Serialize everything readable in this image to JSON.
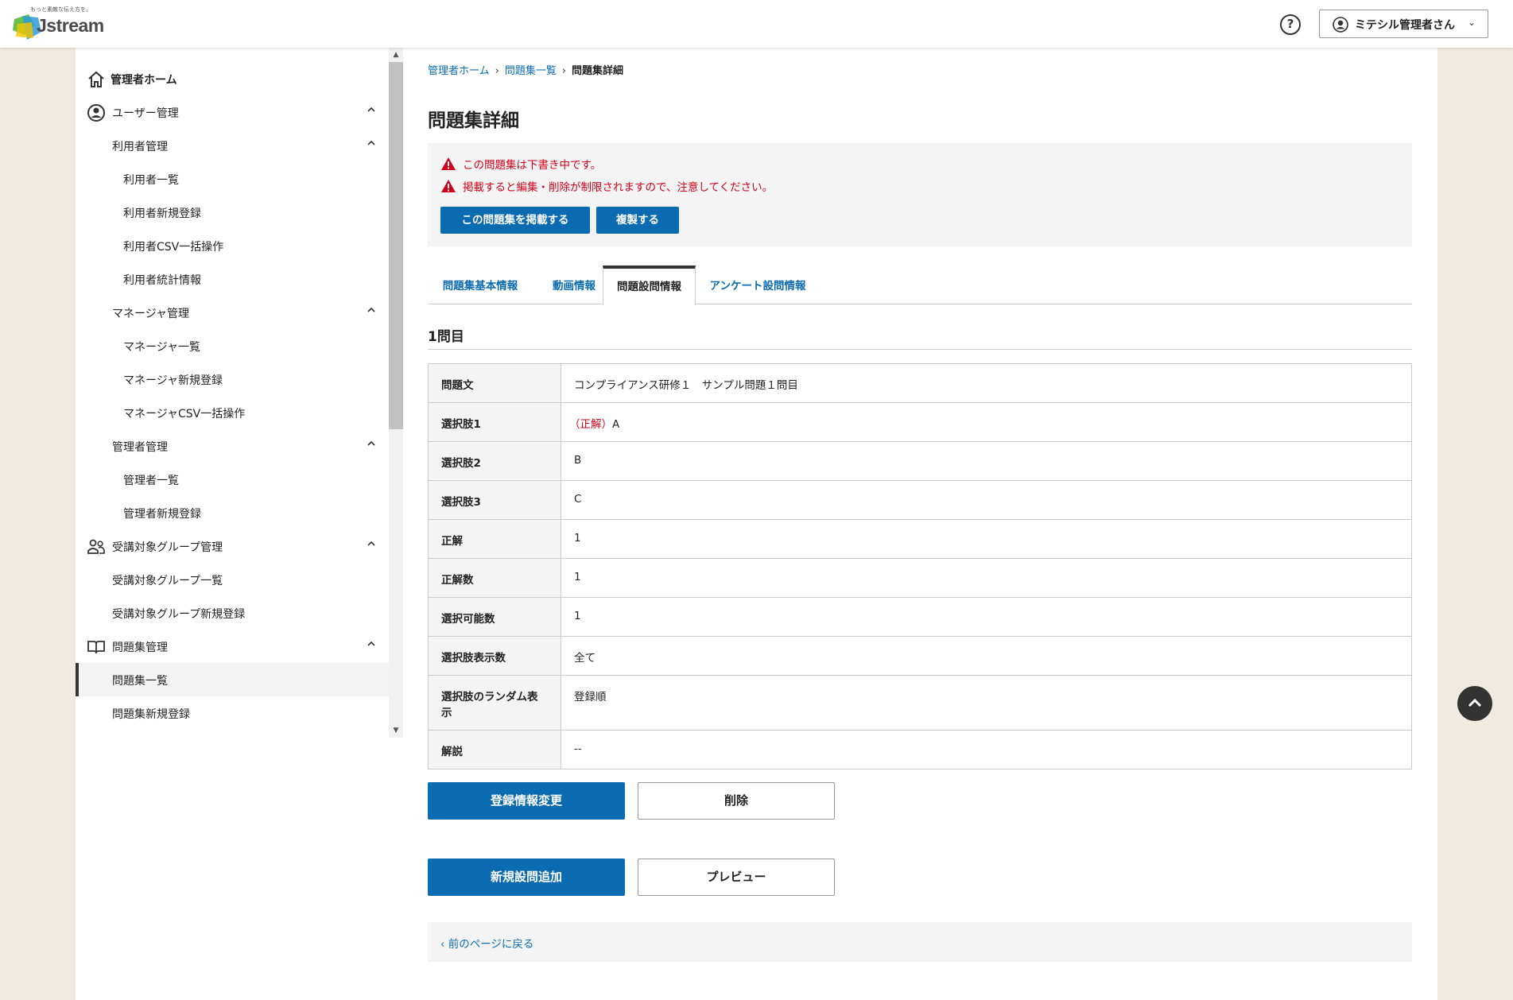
{
  "header": {
    "logo_tagline": "もっと素敵な伝え方を。",
    "logo_text": "Jstream",
    "help_label": "?",
    "user_name": "ミテシル管理者さん"
  },
  "sidebar": {
    "home": "管理者ホーム",
    "user_mgmt": "ユーザー管理",
    "user_sub": "利用者管理",
    "user_list": "利用者一覧",
    "user_new": "利用者新規登録",
    "user_csv": "利用者CSV一括操作",
    "user_stats": "利用者統計情報",
    "mgr_sub": "マネージャ管理",
    "mgr_list": "マネージャ一覧",
    "mgr_new": "マネージャ新規登録",
    "mgr_csv": "マネージャCSV一括操作",
    "admin_sub": "管理者管理",
    "admin_list": "管理者一覧",
    "admin_new": "管理者新規登録",
    "group_mgmt": "受講対象グループ管理",
    "group_list": "受講対象グループ一覧",
    "group_new": "受講対象グループ新規登録",
    "quiz_mgmt": "問題集管理",
    "quiz_list": "問題集一覧",
    "quiz_new": "問題集新規登録"
  },
  "breadcrumb": {
    "home": "管理者ホーム",
    "list": "問題集一覧",
    "current": "問題集詳細"
  },
  "page_title": "問題集詳細",
  "alert": {
    "line1": "この問題集は下書き中です。",
    "line2": "掲載すると編集・削除が制限されますので、注意してください。",
    "publish_btn": "この問題集を掲載する",
    "copy_btn": "複製する"
  },
  "tabs": {
    "basic": "問題集基本情報",
    "video": "動画情報",
    "question": "問題設問情報",
    "survey": "アンケート設問情報"
  },
  "section_title": "1問目",
  "table": {
    "q_label": "問題文",
    "q_value": "コンプライアンス研修１　サンプル問題１問目",
    "c1_label": "選択肢1",
    "c1_correct": "（正解）",
    "c1_value": "A",
    "c2_label": "選択肢2",
    "c2_value": "B",
    "c3_label": "選択肢3",
    "c3_value": "C",
    "ans_label": "正解",
    "ans_value": "1",
    "ans_count_label": "正解数",
    "ans_count_value": "1",
    "selectable_label": "選択可能数",
    "selectable_value": "1",
    "display_label": "選択肢表示数",
    "display_value": "全て",
    "random_label": "選択肢のランダム表示",
    "random_value": "登録順",
    "explain_label": "解説",
    "explain_value": "--"
  },
  "buttons": {
    "edit": "登録情報変更",
    "delete": "削除",
    "add_question": "新規設問追加",
    "preview": "プレビュー"
  },
  "back_link": "前のページに戻る",
  "colors": {
    "accent": "#0b6bb1",
    "alert": "#d0021b",
    "page_bg": "#f1ebdf"
  }
}
